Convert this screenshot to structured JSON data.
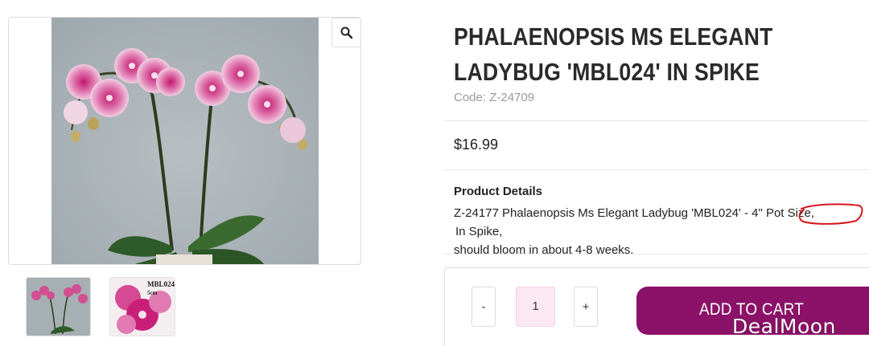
{
  "product": {
    "title_line1": "PHALAENOPSIS MS ELEGANT",
    "title_line2": "LADYBUG 'MBL024' IN SPIKE",
    "code": "Code: Z-24709",
    "price": "$16.99",
    "details_heading": "Product Details",
    "details_part1": "Z-24177 Phalaenopsis Ms Elegant Ladybug 'MBL024' - 4\" Pot Size,",
    "details_circled": "In Spike,",
    "details_part2": "should bloom in about 4-8 weeks."
  },
  "gallery": {
    "zoom_icon": "magnifier-icon",
    "thumb_label_1": "MBL024",
    "thumb_label_2": "5cm"
  },
  "cart": {
    "minus_label": "-",
    "quantity": "1",
    "plus_label": "+",
    "add_label": "ADD TO CART"
  },
  "watermark": "DealMoon",
  "colors": {
    "accent": "#8b1268",
    "qty_bg": "#fbe8f3",
    "annotation": "#d8141c"
  }
}
